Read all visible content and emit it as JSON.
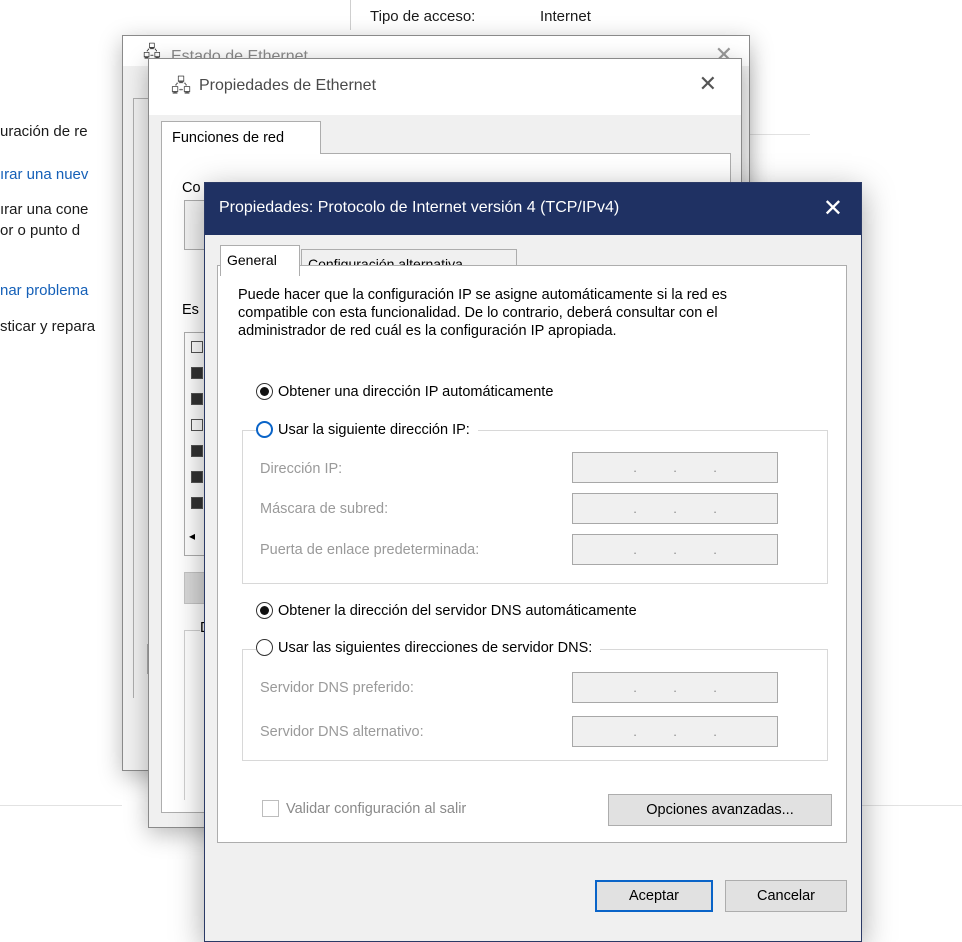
{
  "background": {
    "top_label": "Tipo de acceso:",
    "top_value": "Internet",
    "left_lines": [
      {
        "text": "uración de re",
        "link": false
      },
      {
        "text": "ırar una nuev",
        "link": true
      },
      {
        "text": "ırar una cone",
        "link": false
      },
      {
        "text": "or o punto d",
        "link": false
      },
      {
        "text": "nar problema",
        "link": true
      },
      {
        "text": "sticar y repara",
        "link": false
      }
    ]
  },
  "status_window": {
    "title": "Estado de Ethernet"
  },
  "properties_window": {
    "title": "Propiedades de Ethernet",
    "tab": "Funciones de red",
    "partial_labels": [
      "Co",
      "Es",
      "D"
    ]
  },
  "dialog": {
    "title": "Propiedades: Protocolo de Internet versión 4 (TCP/IPv4)",
    "tabs": [
      "General",
      "Configuración alternativa"
    ],
    "description": "Puede hacer que la configuración IP se asigne automáticamente si la red es compatible con esta funcionalidad. De lo contrario, deberá consultar con el administrador de red cuál es la configuración IP apropiada.",
    "ip_auto_label": "Obtener una dirección IP automáticamente",
    "ip_manual_label": "Usar la siguiente dirección IP:",
    "ip_fields": [
      "Dirección IP:",
      "Máscara de subred:",
      "Puerta de enlace predeterminada:"
    ],
    "dns_auto_label": "Obtener la dirección del servidor DNS automáticamente",
    "dns_manual_label": "Usar las siguientes direcciones de servidor DNS:",
    "dns_fields": [
      "Servidor DNS preferido:",
      "Servidor DNS alternativo:"
    ],
    "ip_placeholder_dots": [
      ".",
      ".",
      "."
    ],
    "validate_label": "Validar configuración al salir",
    "advanced_button": "Opciones avanzadas...",
    "ok_button": "Aceptar",
    "cancel_button": "Cancelar"
  }
}
